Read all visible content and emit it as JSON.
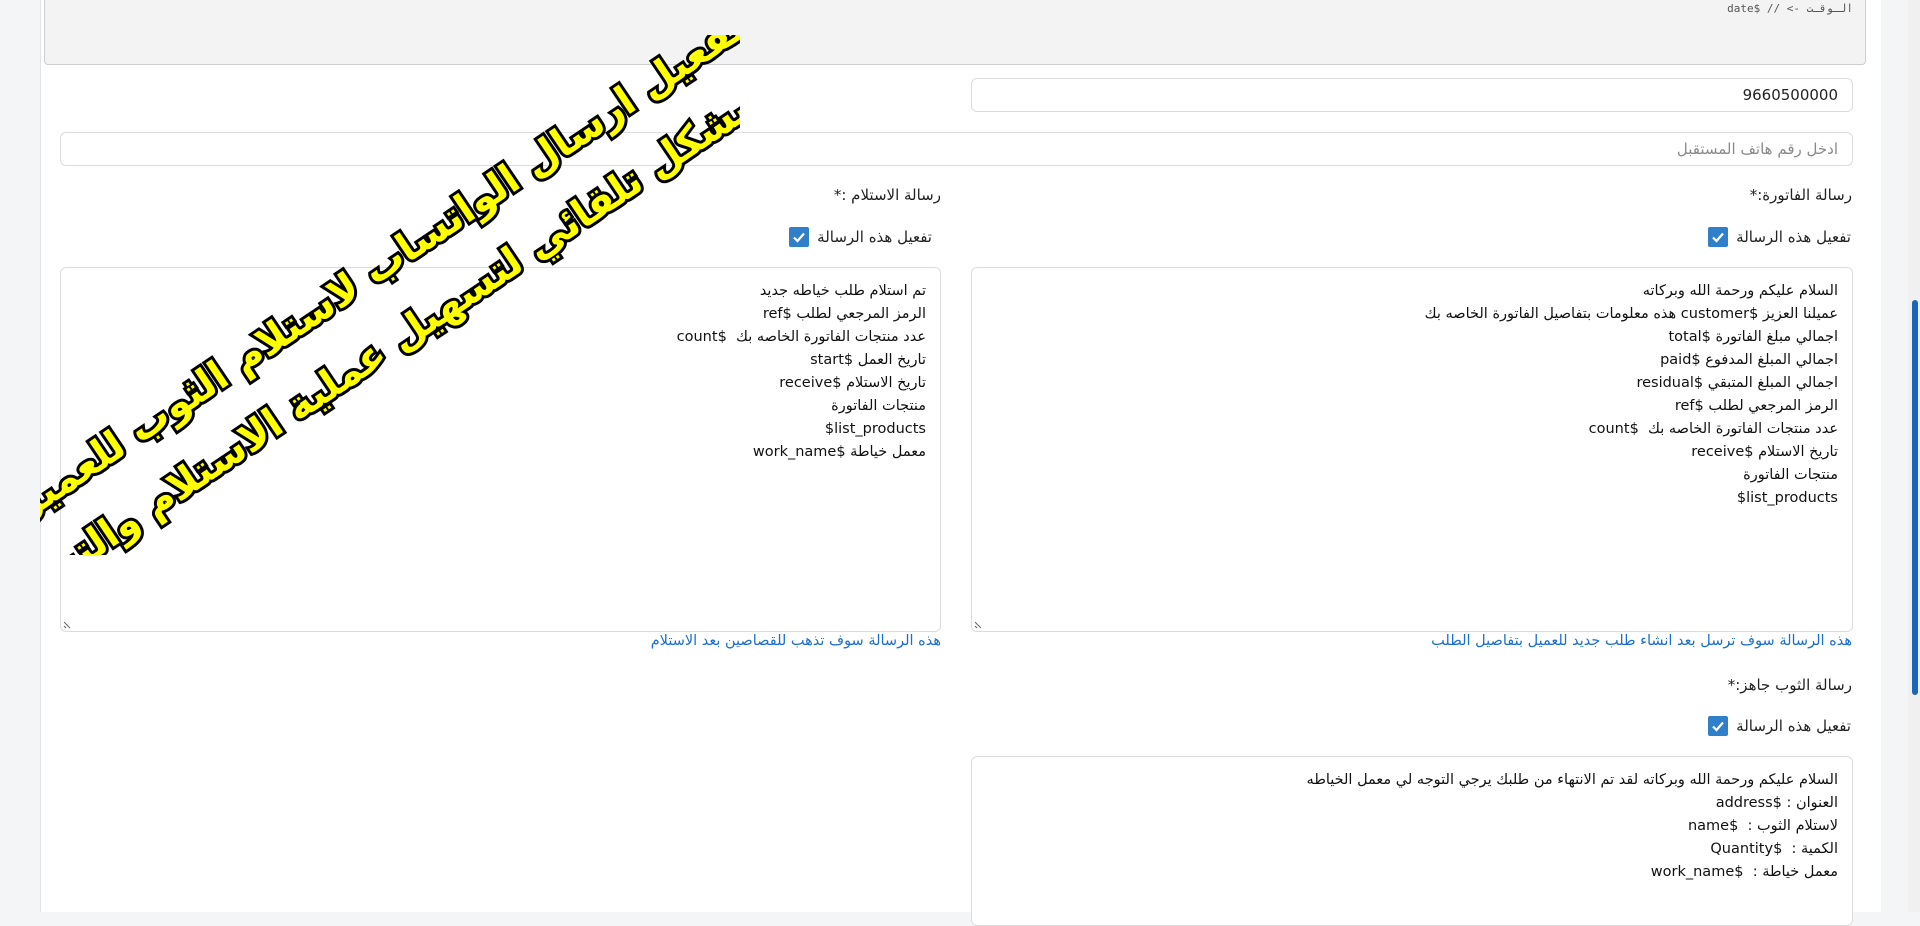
{
  "template_hint": "الـوقـت -> // $date",
  "phone_value": "9660500000",
  "receiver_phone": {
    "placeholder": "ادخل رقم هاتف المستقبل"
  },
  "invoice_message": {
    "label": "رسالة الفاتورة:*",
    "enable_label": "تفعيل هذه الرسالة",
    "lines": [
      "السلام عليكم ورحمة الله وبركاته",
      "عميلنا العزيز $customer هذه معلومات بتفاصيل الفاتورة الخاصه بك",
      "اجمالي مبلغ الفاتورة $total",
      "اجمالي المبلغ المدفوع $paid",
      "اجمالي المبلغ المتبقي $residual",
      "الرمز المرجعي لطلب $ref",
      "عدد منتجات الفاتورة الخاصه بك  $count",
      "تاريخ الاستلام $receive",
      "منتجات الفاتورة",
      "$list_products"
    ],
    "help": "هذه الرسالة سوف ترسل بعد انشاء طلب جديد للعميل بتفاصيل الطلب"
  },
  "receipt_message": {
    "label": "رسالة الاستلام :*",
    "enable_label": "تفعيل هذه الرسالة",
    "lines": [
      "تم استلام طلب خياطه جديد",
      "الرمز المرجعي لطلب $ref",
      "عدد منتجات الفاتورة الخاصه بك  $count",
      "تاريخ العمل $start",
      "تاريخ الاستلام $receive",
      "منتجات الفاتورة",
      "$list_products",
      "معمل خياطة $work_name"
    ],
    "help": "هذه الرسالة سوف تذهب للقصاصين بعد الاستلام"
  },
  "ready_message": {
    "label": "رسالة الثوب جاهز:*",
    "enable_label": "تفعيل هذه الرسالة",
    "lines": [
      "السلام عليكم ورحمة الله وبركاته لقد تم الانتهاء من طلبك يرجي التوجه لي معمل الخياطه",
      "العنوان : $address",
      "لاستلام الثوب :  $name",
      "الكمية :  $Quantity",
      "معمل خياطة :  $work_name"
    ]
  },
  "overlay": {
    "line1": "تفعيل ارسال الواتساب لاستلام الثوب للعميل",
    "line2": "تعمل بشكل تلقائي لتسهيل عملية الاستلام والتسليم",
    "fill_color": "#ffff00",
    "stroke_color": "#000000"
  },
  "colors": {
    "accent": "#2f80c9",
    "help_text": "#1a6fc9"
  }
}
